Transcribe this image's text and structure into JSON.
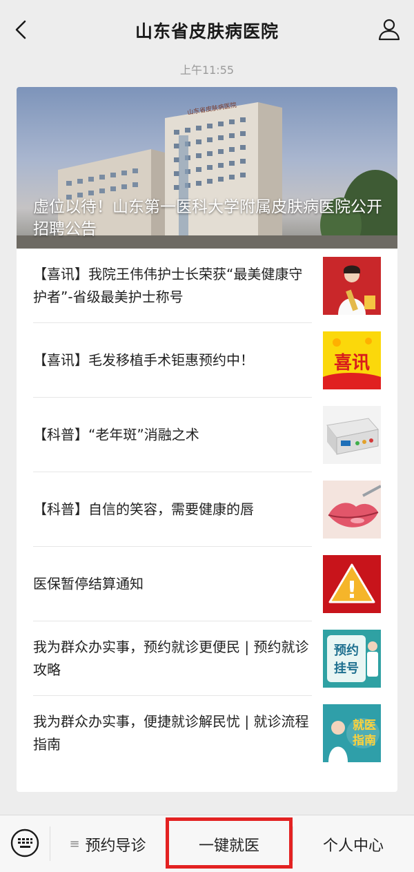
{
  "header": {
    "title": "山东省皮肤病医院",
    "back_icon": "chevron-left-icon",
    "profile_icon": "person-icon"
  },
  "timestamp": "上午11:55",
  "hero": {
    "sign_text": "山东省皮肤病医院",
    "title": "虚位以待！山东第一医科大学附属皮肤病医院公开招聘公告"
  },
  "articles": [
    {
      "title": "【喜讯】我院王伟伟护士长荣获“最美健康守护者”-省级最美护士称号",
      "thumb": "nurse-award-photo"
    },
    {
      "title": "【喜讯】毛发移植手术钜惠预约中！",
      "thumb": "xixun-graphic",
      "thumb_text": "喜讯"
    },
    {
      "title": "【科普】“老年斑”消融之术",
      "thumb": "medical-device-photo"
    },
    {
      "title": "【科普】自信的笑容，需要健康的唇",
      "thumb": "lips-photo"
    },
    {
      "title": "医保暂停结算通知",
      "thumb": "warning-icon",
      "thumb_text": "!"
    },
    {
      "title": "我为群众办实事，预约就诊更便民 | 预约就诊攻略",
      "thumb": "appointment-graphic",
      "thumb_text": [
        "预约",
        "挂号"
      ]
    },
    {
      "title": "我为群众办实事，便捷就诊解民忧 | 就诊流程指南",
      "thumb": "guide-graphic",
      "thumb_text": [
        "就医",
        "指南"
      ]
    }
  ],
  "bottom_menu": {
    "keyboard_icon": "keyboard-icon",
    "lines_glyph": "≡",
    "items": [
      "预约导诊",
      "一键就医",
      "个人中心"
    ]
  },
  "colors": {
    "highlight_border": "#e32222",
    "background": "#ededed"
  }
}
